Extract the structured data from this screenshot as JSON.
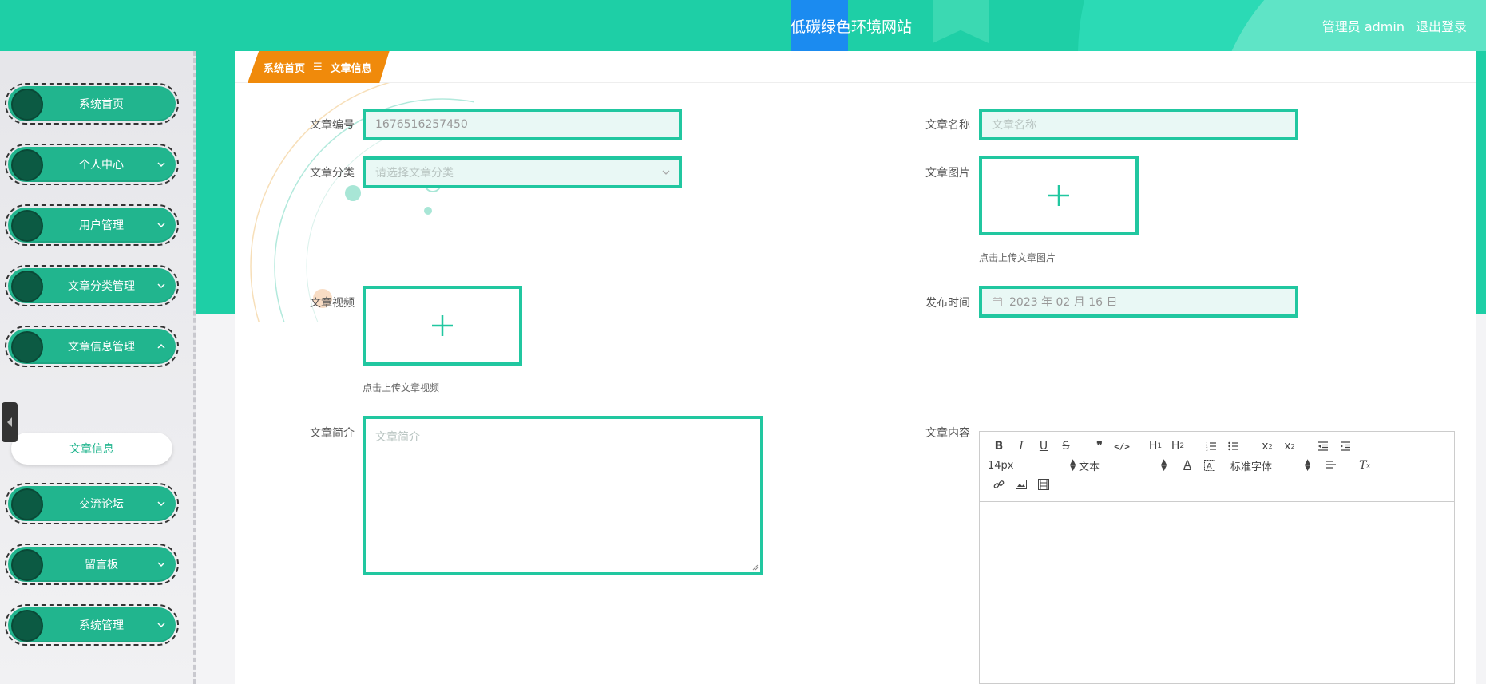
{
  "header": {
    "site_title": "低碳绿色环境网站",
    "user_label": "管理员 admin",
    "logout_label": "退出登录"
  },
  "sidebar": {
    "items": [
      {
        "label": "系统首页",
        "has_chevron": false
      },
      {
        "label": "个人中心",
        "has_chevron": true
      },
      {
        "label": "用户管理",
        "has_chevron": true
      },
      {
        "label": "文章分类管理",
        "has_chevron": true
      },
      {
        "label": "文章信息管理",
        "has_chevron": true,
        "expanded": true
      },
      {
        "label": "交流论坛",
        "has_chevron": true
      },
      {
        "label": "留言板",
        "has_chevron": true
      },
      {
        "label": "系统管理",
        "has_chevron": true
      }
    ],
    "submenu": {
      "label": "文章信息"
    }
  },
  "breadcrumb": {
    "home": "系统首页",
    "separator": "☰",
    "current": "文章信息"
  },
  "form": {
    "article_no": {
      "label": "文章编号",
      "value": "1676516257450"
    },
    "article_name": {
      "label": "文章名称",
      "placeholder": "文章名称"
    },
    "category": {
      "label": "文章分类",
      "placeholder": "请选择文章分类"
    },
    "image": {
      "label": "文章图片",
      "hint": "点击上传文章图片"
    },
    "video": {
      "label": "文章视频",
      "hint": "点击上传文章视频"
    },
    "publish_time": {
      "label": "发布时间",
      "value": "2023 年 02 月 16 日"
    },
    "summary": {
      "label": "文章简介",
      "placeholder": "文章简介"
    },
    "content": {
      "label": "文章内容"
    }
  },
  "editor": {
    "font_size": "14px",
    "block_type": "文本",
    "font_family": "标准字体",
    "buttons_row1": [
      "B",
      "I",
      "U",
      "S",
      "❞",
      "</>",
      "H1",
      "H2",
      "ol",
      "ul",
      "x₂",
      "x²",
      "outdent",
      "indent"
    ],
    "buttons_row2": [
      "font-color",
      "bg-color",
      "align",
      "clear-format"
    ],
    "buttons_row3": [
      "link",
      "image",
      "video"
    ]
  },
  "colors": {
    "brand_teal": "#1ecfa6",
    "menu_green": "#21b58e",
    "breadcrumb_orange": "#f08a0b",
    "input_border": "#21c7a0",
    "title_highlight": "#1b8bf0"
  }
}
